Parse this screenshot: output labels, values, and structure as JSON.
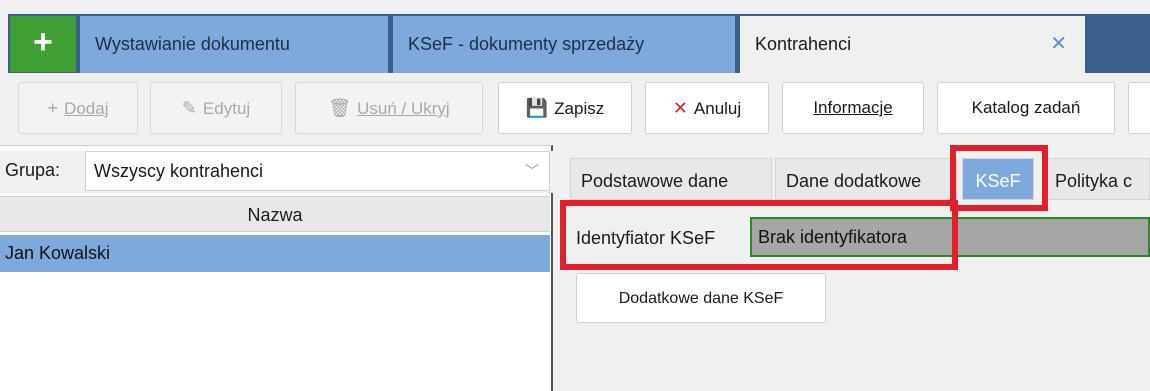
{
  "tabs": {
    "add_symbol": "+",
    "items": [
      {
        "label": "Wystawianie dokumentu"
      },
      {
        "label": "KSeF - dokumenty sprzedaży"
      },
      {
        "label": "Kontrahenci",
        "close": "✕"
      }
    ]
  },
  "toolbar": {
    "add": {
      "icon": "+",
      "label": "Dodaj"
    },
    "edit": {
      "icon": "✎",
      "label": "Edytuj"
    },
    "delete": {
      "icon": "🗑",
      "label": "Usuń / Ukryj"
    },
    "save": {
      "icon": "💾",
      "label": "Zapisz"
    },
    "cancel": {
      "icon": "✕",
      "label": "Anuluj"
    },
    "info": {
      "label": "Informacje"
    },
    "catalog": {
      "label": "Katalog zadań"
    }
  },
  "left": {
    "group_label": "Grupa:",
    "group_value": "Wszyscy kontrahenci",
    "column_header": "Nazwa",
    "rows": [
      "Jan Kowalski"
    ]
  },
  "right": {
    "tabs": [
      "Podstawowe dane",
      "Dane dodatkowe",
      "KSeF",
      "Polityka c"
    ],
    "ksef_id_label": "Identyfiator KSeF",
    "ksef_id_value": "Brak identyfikatora",
    "extra_button": "Dodatkowe dane KSeF"
  },
  "colors": {
    "accent_blue": "#7da9dc",
    "dark_blue": "#3a5f8c",
    "green": "#41a035",
    "highlight_red": "#e3202a"
  }
}
